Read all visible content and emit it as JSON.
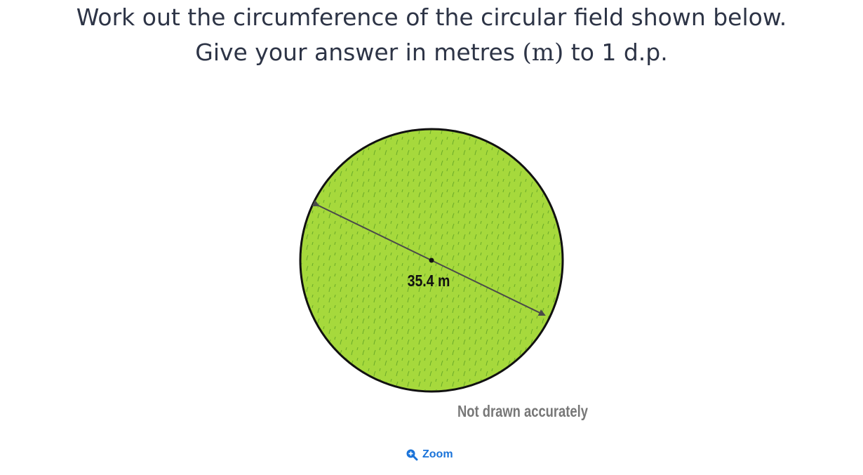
{
  "question": {
    "line1": "Work out the circumference of the circular field shown below.",
    "line2_before": "Give your answer in metres ",
    "line2_unit": "(m)",
    "line2_after": " to 1 d.p."
  },
  "figure": {
    "diameter_label": "35.4 m",
    "note": "Not drawn accurately",
    "fill_color": "#a6d93c",
    "grass_color": "#6fae2a",
    "outline_color": "#111111",
    "arrow_color": "#4a4a4a"
  },
  "zoom": {
    "label": "Zoom",
    "icon": "zoom-in-icon"
  }
}
